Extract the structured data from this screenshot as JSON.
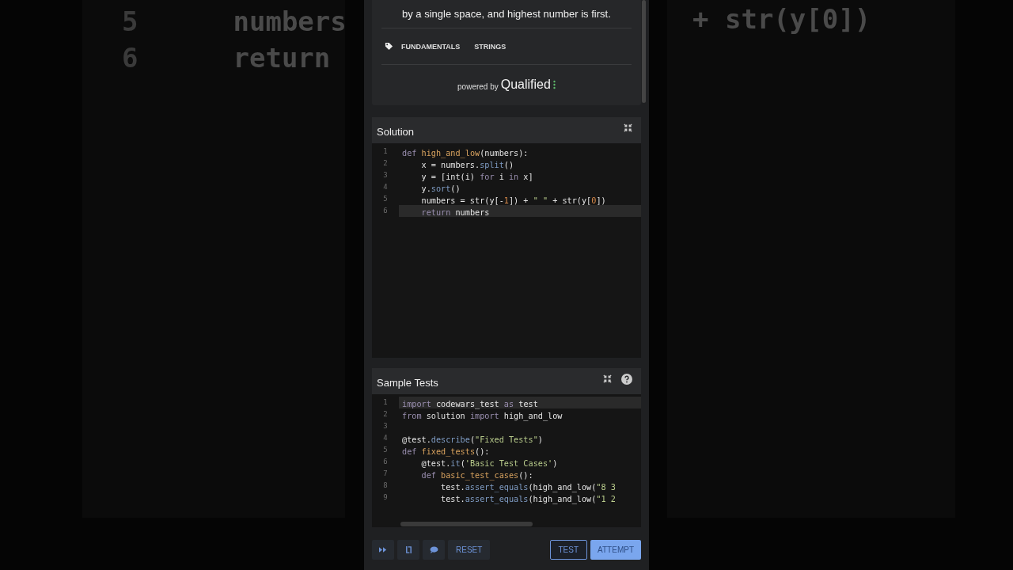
{
  "backdrop": {
    "code_lines": [
      {
        "number": "5",
        "text": "numbers"
      },
      {
        "number": "6",
        "text": "return"
      }
    ],
    "right_text": "+ str(y[0])"
  },
  "description": {
    "text": "by a single space, and highest number is first.",
    "tags": [
      "FUNDAMENTALS",
      "STRINGS"
    ],
    "powered_by": "powered by",
    "brand": "Qualified"
  },
  "solution": {
    "title": "Solution",
    "lines": [
      {
        "number": "1",
        "active": false,
        "tokens": [
          {
            "t": "def ",
            "kind": "keyword"
          },
          {
            "t": "high_and_low",
            "kind": "function"
          },
          {
            "t": "(numbers):",
            "kind": "plain"
          }
        ]
      },
      {
        "number": "2",
        "active": false,
        "tokens": [
          {
            "t": "    x = numbers.",
            "kind": "plain"
          },
          {
            "t": "split",
            "kind": "method"
          },
          {
            "t": "()",
            "kind": "plain"
          }
        ]
      },
      {
        "number": "3",
        "active": false,
        "tokens": [
          {
            "t": "    y = [int(i) ",
            "kind": "plain"
          },
          {
            "t": "for",
            "kind": "keyword"
          },
          {
            "t": " i ",
            "kind": "plain"
          },
          {
            "t": "in",
            "kind": "keyword"
          },
          {
            "t": " x]",
            "kind": "plain"
          }
        ]
      },
      {
        "number": "4",
        "active": false,
        "tokens": [
          {
            "t": "    y.",
            "kind": "plain"
          },
          {
            "t": "sort",
            "kind": "method"
          },
          {
            "t": "()",
            "kind": "plain"
          }
        ]
      },
      {
        "number": "5",
        "active": false,
        "tokens": [
          {
            "t": "    numbers = str(y[-",
            "kind": "plain"
          },
          {
            "t": "1",
            "kind": "number"
          },
          {
            "t": "]) + ",
            "kind": "plain"
          },
          {
            "t": "\" \"",
            "kind": "string"
          },
          {
            "t": " + str(y[",
            "kind": "plain"
          },
          {
            "t": "0",
            "kind": "number"
          },
          {
            "t": "])",
            "kind": "plain"
          }
        ]
      },
      {
        "number": "6",
        "active": true,
        "tokens": [
          {
            "t": "    return",
            "kind": "keyword"
          },
          {
            "t": " numbers",
            "kind": "plain"
          }
        ]
      }
    ]
  },
  "sample_tests": {
    "title": "Sample Tests",
    "lines": [
      {
        "number": "1",
        "active": true,
        "tokens": [
          {
            "t": "import",
            "kind": "keyword"
          },
          {
            "t": " codewars_test ",
            "kind": "plain"
          },
          {
            "t": "as",
            "kind": "keyword"
          },
          {
            "t": " test",
            "kind": "plain"
          }
        ]
      },
      {
        "number": "2",
        "active": false,
        "tokens": [
          {
            "t": "from",
            "kind": "keyword"
          },
          {
            "t": " solution ",
            "kind": "plain"
          },
          {
            "t": "import",
            "kind": "keyword"
          },
          {
            "t": " high_and_low",
            "kind": "plain"
          }
        ]
      },
      {
        "number": "3",
        "active": false
      },
      {
        "number": "4",
        "active": false,
        "tokens": [
          {
            "t": "@test.",
            "kind": "plain"
          },
          {
            "t": "describe",
            "kind": "method"
          },
          {
            "t": "(",
            "kind": "plain"
          },
          {
            "t": "\"Fixed Tests\"",
            "kind": "string"
          },
          {
            "t": ")",
            "kind": "plain"
          }
        ]
      },
      {
        "number": "5",
        "active": false,
        "tokens": [
          {
            "t": "def ",
            "kind": "keyword"
          },
          {
            "t": "fixed_tests",
            "kind": "function"
          },
          {
            "t": "():",
            "kind": "plain"
          }
        ]
      },
      {
        "number": "6",
        "active": false,
        "tokens": [
          {
            "t": "    @test.",
            "kind": "plain"
          },
          {
            "t": "it",
            "kind": "method"
          },
          {
            "t": "(",
            "kind": "plain"
          },
          {
            "t": "'Basic Test Cases'",
            "kind": "string"
          },
          {
            "t": ")",
            "kind": "plain"
          }
        ]
      },
      {
        "number": "7",
        "active": false,
        "tokens": [
          {
            "t": "    def ",
            "kind": "keyword"
          },
          {
            "t": "basic_test_cases",
            "kind": "function"
          },
          {
            "t": "():",
            "kind": "plain"
          }
        ]
      },
      {
        "number": "8",
        "active": false,
        "tokens": [
          {
            "t": "        test.",
            "kind": "plain"
          },
          {
            "t": "assert_equals",
            "kind": "method"
          },
          {
            "t": "(high_and_low(",
            "kind": "plain"
          },
          {
            "t": "\"8 3",
            "kind": "string"
          }
        ]
      },
      {
        "number": "9",
        "active": false,
        "tokens": [
          {
            "t": "        test.",
            "kind": "plain"
          },
          {
            "t": "assert_equals",
            "kind": "method"
          },
          {
            "t": "(high_and_low(",
            "kind": "plain"
          },
          {
            "t": "\"1 2",
            "kind": "string"
          }
        ]
      }
    ]
  },
  "actions": {
    "reset": "RESET",
    "test": "TEST",
    "attempt": "ATTEMPT"
  }
}
